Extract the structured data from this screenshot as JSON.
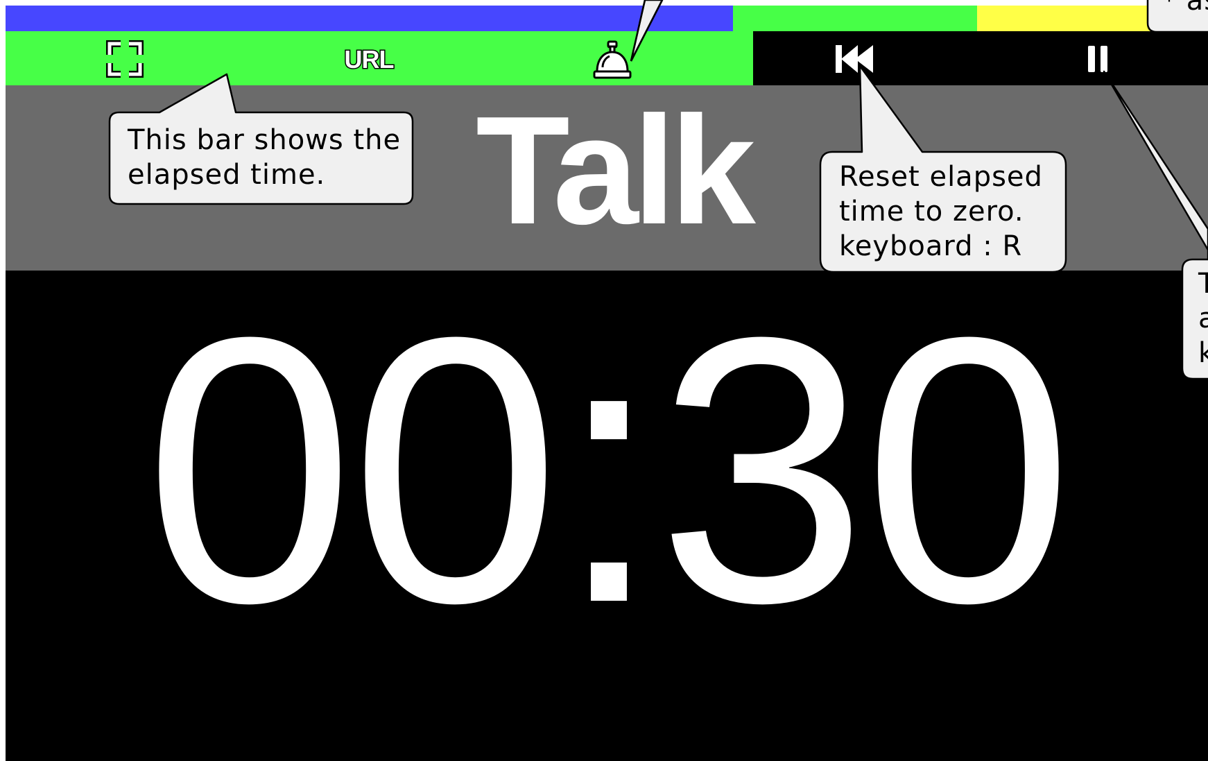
{
  "progress_bar": {
    "segments": [
      {
        "name": "elapsed",
        "color": "#4747ff",
        "fraction": 0.605
      },
      {
        "name": "warning",
        "color": "#47ff47",
        "fraction": 0.203
      },
      {
        "name": "final",
        "color": "#ffff47",
        "fraction": 0.192
      }
    ]
  },
  "toolbar": {
    "fullscreen_icon": "fullscreen-icon",
    "url_label": "URL",
    "bell_icon": "bell-icon",
    "reset_icon": "skip-back-icon",
    "pause_icon": "pause-icon",
    "left_color": "#47ff47",
    "right_color": "#000000"
  },
  "title": "Talk",
  "timer": "00:30",
  "colors": {
    "title_bg": "#6b6b6b",
    "timer_bg": "#000000",
    "callout_bg": "#f0f0f0"
  },
  "callouts": {
    "progress": "This bar shows the\nelapsed time.",
    "reset": "Reset elapsed\ntime to zero.\nkeyboard : R",
    "top_right_fragment": "* as",
    "right_fragment": "T\na\nk"
  }
}
